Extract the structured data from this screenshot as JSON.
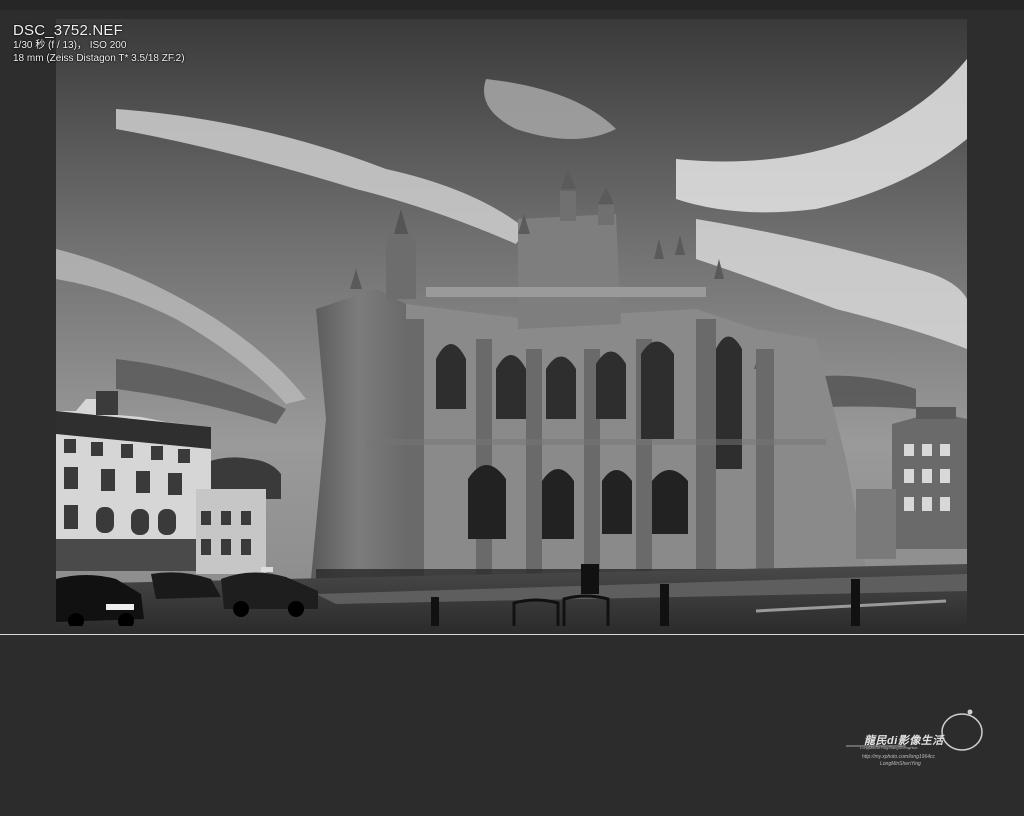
{
  "photo_info": {
    "filename": "DSC_3752.NEF",
    "exposure": "1/30 秒 (f / 13)， ISO 200",
    "lens": "18 mm (Zeiss Distagon T* 3.5/18 ZF.2)"
  },
  "photo": {
    "subject": "bath-abbey-photo",
    "plate_left": "LA05 FYT"
  },
  "watermark": {
    "title": "龍民di影像生活",
    "subtitle": "LongMinDeYingXiangShengHuo",
    "url": "http://my.xphoto.com/long1964cc",
    "signature": "LongMinShenYing"
  },
  "colors": {
    "background": "#2d2d2d",
    "divider": "#d8d8d8",
    "info_text": "#f2f2f2"
  }
}
